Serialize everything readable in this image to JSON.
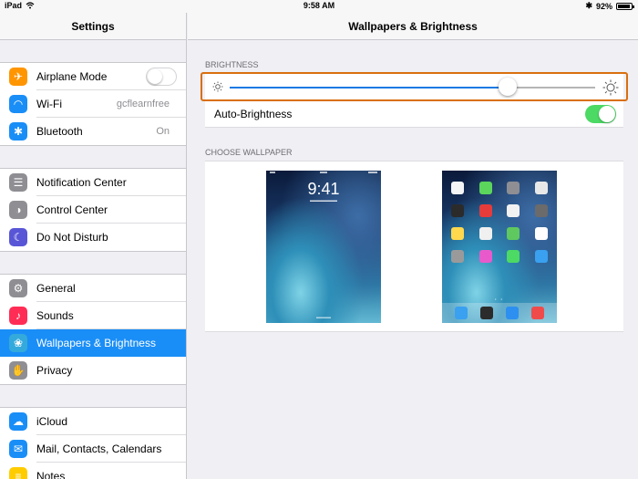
{
  "status_bar": {
    "device": "iPad",
    "time": "9:58 AM",
    "battery": "92%",
    "battery_level": 0.92
  },
  "sidebar": {
    "title": "Settings",
    "groups": [
      [
        {
          "label": "Airplane Mode",
          "icon": "airplane-icon",
          "color": "#ff9500",
          "control": "toggle"
        },
        {
          "label": "Wi-Fi",
          "icon": "wifi-icon",
          "color": "#1a8ef7",
          "value": "gcflearnfree"
        },
        {
          "label": "Bluetooth",
          "icon": "bluetooth-icon",
          "color": "#1a8ef7",
          "value": "On"
        }
      ],
      [
        {
          "label": "Notification Center",
          "icon": "notification-center-icon",
          "color": "#8e8e93"
        },
        {
          "label": "Control Center",
          "icon": "control-center-icon",
          "color": "#8e8e93"
        },
        {
          "label": "Do Not Disturb",
          "icon": "moon-icon",
          "color": "#5856d6"
        }
      ],
      [
        {
          "label": "General",
          "icon": "gear-icon",
          "color": "#8e8e93"
        },
        {
          "label": "Sounds",
          "icon": "speaker-icon",
          "color": "#ff2d55"
        },
        {
          "label": "Wallpapers & Brightness",
          "icon": "flower-icon",
          "color": "#34aadc",
          "selected": true
        },
        {
          "label": "Privacy",
          "icon": "hand-icon",
          "color": "#8e8e93"
        }
      ],
      [
        {
          "label": "iCloud",
          "icon": "cloud-icon",
          "color": "#1a8ef7"
        },
        {
          "label": "Mail, Contacts, Calendars",
          "icon": "mail-icon",
          "color": "#1a8ef7"
        },
        {
          "label": "Notes",
          "icon": "notes-icon",
          "color": "#ffcc00"
        }
      ]
    ]
  },
  "main": {
    "title": "Wallpapers & Brightness",
    "brightness": {
      "section": "BRIGHTNESS",
      "level": 0.76
    },
    "auto_brightness": {
      "label": "Auto-Brightness",
      "on": true
    },
    "wallpaper": {
      "section": "CHOOSE WALLPAPER",
      "lock_time": "9:41"
    }
  },
  "colors": {
    "accent": "#1a8ef7",
    "toggle_on": "#4cd964",
    "highlight": "#d96f0f"
  }
}
